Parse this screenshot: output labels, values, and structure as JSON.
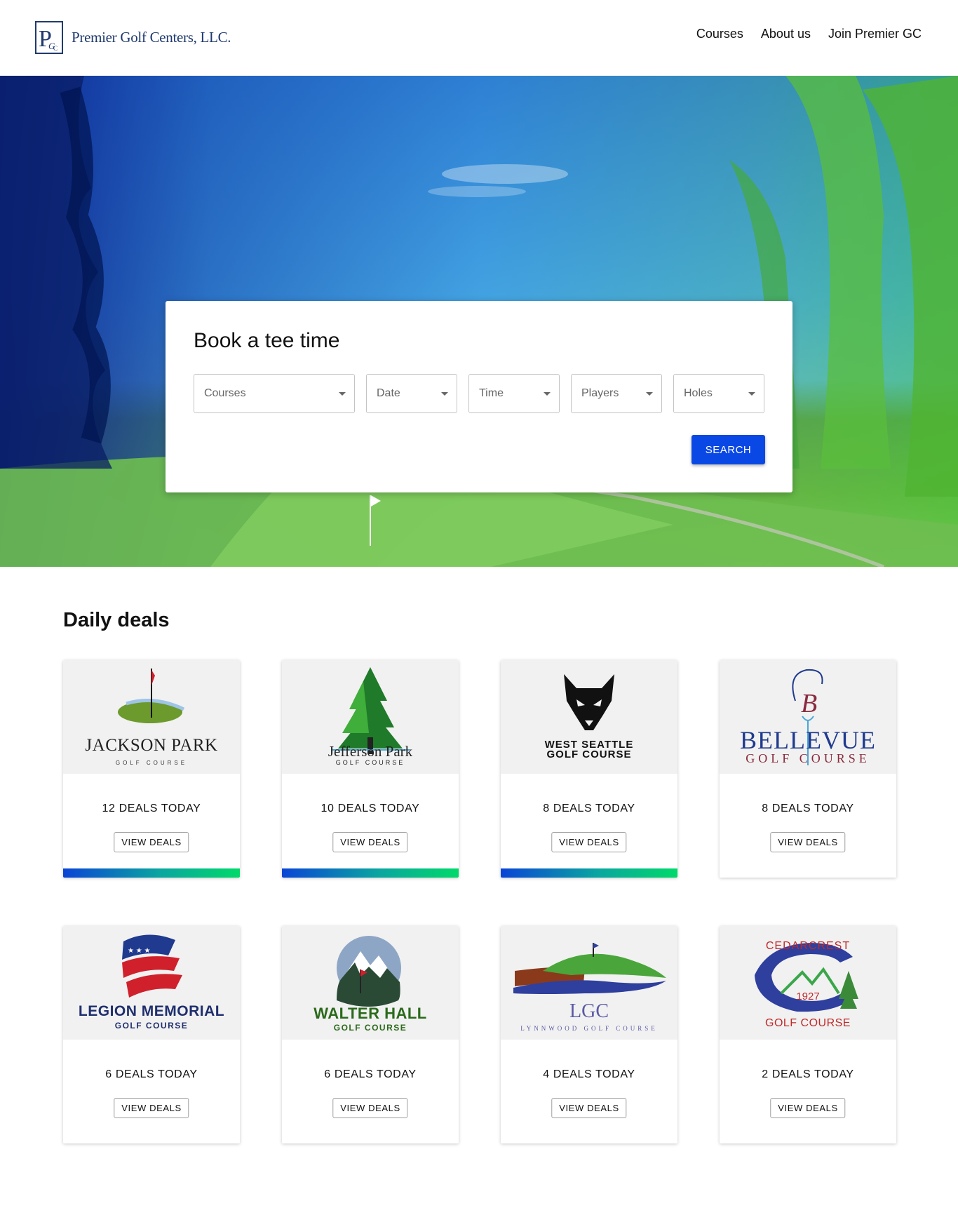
{
  "header": {
    "brand_name": "Premier Golf Centers, LLC.",
    "brand_monogram": "PGC",
    "nav": [
      {
        "label": "Courses"
      },
      {
        "label": "About us"
      },
      {
        "label": "Join Premier GC"
      }
    ]
  },
  "booking": {
    "title": "Book a tee time",
    "fields": [
      {
        "placeholder": "Courses"
      },
      {
        "placeholder": "Date"
      },
      {
        "placeholder": "Time"
      },
      {
        "placeholder": "Players"
      },
      {
        "placeholder": "Holes"
      }
    ],
    "search_label": "SEARCH"
  },
  "deals": {
    "title": "Daily deals",
    "view_label": "VIEW DEALS",
    "cards": [
      {
        "course": "Jackson Park",
        "logo_line1": "JACKSON PARK",
        "logo_line2": "GOLF COURSE",
        "count": "12 DEALS TODAY",
        "highlighted": true
      },
      {
        "course": "Jefferson Park",
        "logo_line1": "Jefferson Park",
        "logo_line2": "GOLF COURSE",
        "count": "10 DEALS TODAY",
        "highlighted": true
      },
      {
        "course": "West Seattle",
        "logo_line1": "WEST SEATTLE",
        "logo_line2": "GOLF COURSE",
        "count": "8 DEALS TODAY",
        "highlighted": true
      },
      {
        "course": "Bellevue",
        "logo_line1": "BELLEVUE",
        "logo_line2": "GOLF COURSE",
        "count": "8 DEALS TODAY",
        "highlighted": false
      },
      {
        "course": "Legion Memorial",
        "logo_line1": "LEGION MEMORIAL",
        "logo_line2": "GOLF COURSE",
        "count": "6 DEALS TODAY",
        "highlighted": false
      },
      {
        "course": "Walter Hall",
        "logo_line1": "WALTER HALL",
        "logo_line2": "GOLF COURSE",
        "count": "6 DEALS TODAY",
        "highlighted": false
      },
      {
        "course": "Lynnwood",
        "logo_line1": "LGC",
        "logo_line2": "LYNNWOOD GOLF COURSE",
        "count": "4 DEALS TODAY",
        "highlighted": false
      },
      {
        "course": "Cedarcrest",
        "logo_line1": "CEDARCREST",
        "logo_line2": "GOLF COURSE",
        "logo_year": "1927",
        "count": "2 DEALS TODAY",
        "highlighted": false
      }
    ]
  },
  "colors": {
    "brand": "#1f3a6e",
    "search_button": "#0a48e6",
    "card_bar_start": "#0a44d6",
    "card_bar_end": "#00d96a"
  }
}
